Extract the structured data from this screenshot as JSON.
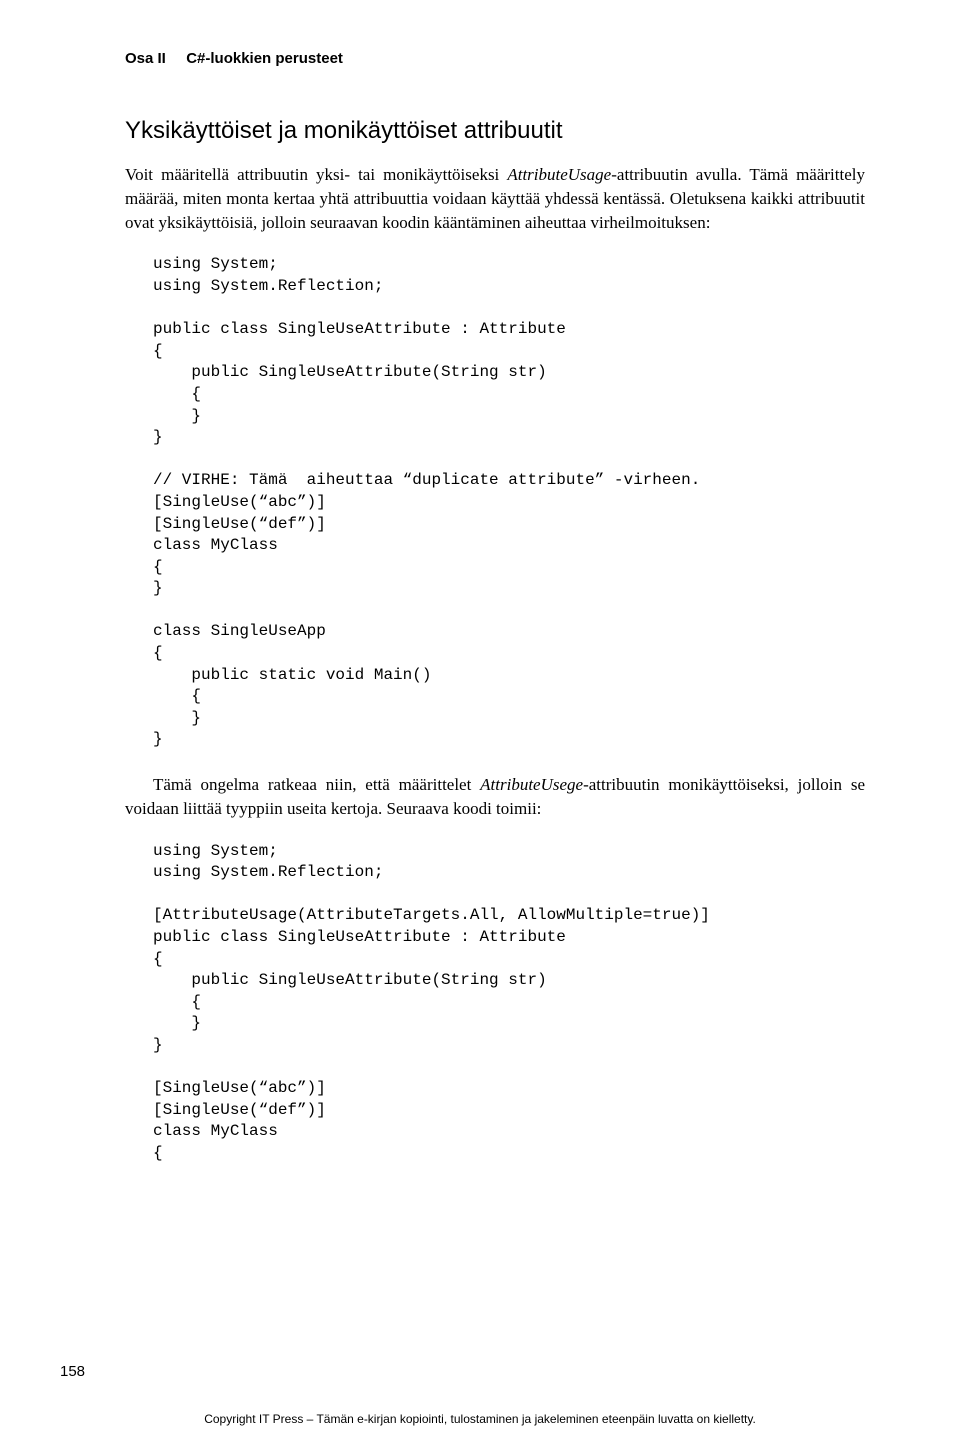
{
  "header": {
    "part": "Osa II",
    "chapter": "C#-luokkien perusteet"
  },
  "section_title": "Yksikäyttöiset ja monikäyttöiset attribuutit",
  "paragraphs": {
    "p1_a": "Voit määritellä attribuutin yksi- tai monikäyttöiseksi ",
    "p1_i1": "AttributeUsage",
    "p1_b": "-attribuutin avulla. Tämä määrittely määrää, miten monta kertaa yhtä attribuuttia voidaan käyttää yhdessä kentässä. Oletuksena kaikki attribuutit ovat yksikäyttöisiä, jolloin seuraavan koodin kääntäminen aiheuttaa virheilmoituksen:",
    "p2_a": "Tämä ongelma ratkeaa niin, että määrittelet ",
    "p2_i1": "AttributeUsege",
    "p2_b": "-attribuutin monikäyttöiseksi, jolloin se voidaan liittää tyyppiin useita kertoja. Seuraava koodi toimii:"
  },
  "code1": "using System;\nusing System.Reflection;\n\npublic class SingleUseAttribute : Attribute\n{\n    public SingleUseAttribute(String str)\n    {\n    }\n}\n\n// VIRHE: Tämä  aiheuttaa “duplicate attribute” -virheen.\n[SingleUse(“abc”)]\n[SingleUse(“def”)]\nclass MyClass\n{\n}\n\nclass SingleUseApp\n{\n    public static void Main()\n    {\n    }\n}",
  "code2": "using System;\nusing System.Reflection;\n\n[AttributeUsage(AttributeTargets.All, AllowMultiple=true)]\npublic class SingleUseAttribute : Attribute\n{\n    public SingleUseAttribute(String str)\n    {\n    }\n}\n\n[SingleUse(“abc”)]\n[SingleUse(“def”)]\nclass MyClass\n{",
  "page_number": "158",
  "footer": "Copyright IT Press – Tämän e-kirjan kopiointi, tulostaminen ja jakeleminen eteenpäin luvatta on kielletty."
}
